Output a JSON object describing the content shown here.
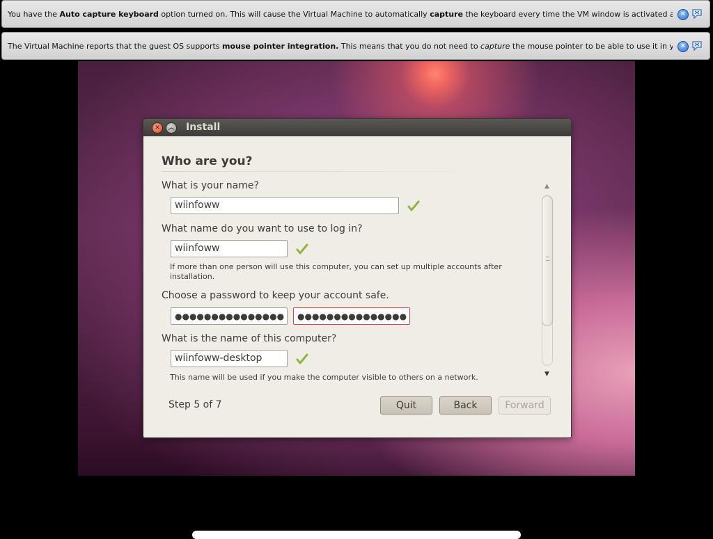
{
  "notifications": [
    {
      "parts": [
        {
          "text": "You have the ",
          "bold": false
        },
        {
          "text": "Auto capture keyboard",
          "bold": true
        },
        {
          "text": " option turned on. This will cause the Virtual Machine to automatically ",
          "bold": false
        },
        {
          "text": "capture",
          "bold": true
        },
        {
          "text": " the keyboard every time the VM window is activated and make it unavailable to",
          "bold": false
        }
      ],
      "close_icon": "close-icon",
      "dismiss_icon": "dismiss-bubble-icon"
    },
    {
      "parts": [
        {
          "text": "The Virtual Machine reports that the guest OS supports ",
          "bold": false
        },
        {
          "text": "mouse pointer integration.",
          "bold": true
        },
        {
          "text": " This means that you do not need to ",
          "bold": false
        },
        {
          "text": "capture",
          "italic": true
        },
        {
          "text": " the mouse pointer to be able to use it in your guest OS -- all mouse",
          "bold": false
        }
      ],
      "close_icon": "close-icon",
      "dismiss_icon": "dismiss-bubble-icon"
    }
  ],
  "window": {
    "title": "Install",
    "close_glyph": "✕",
    "maximize_glyph": "︿"
  },
  "form": {
    "heading": "Who are you?",
    "name_label": "What is your name?",
    "name_value": "wiinfoww",
    "login_label": "What name do you want to use to log in?",
    "login_value": "wiinfoww",
    "login_hint_line1": "If more than one person will use this computer, you can set up multiple accounts after",
    "login_hint_line2": "installation.",
    "password_label": "Choose a password to keep your account safe.",
    "password_value": "●●●●●●●●●●●●●●●",
    "password_confirm_value": "●●●●●●●●●●●●●●●",
    "computer_label": "What is the name of this computer?",
    "computer_value": "wiinfoww-desktop",
    "computer_hint": "This name will be used if you make the computer visible to others on a network."
  },
  "footer": {
    "step": "Step 5 of 7",
    "quit": "Quit",
    "back": "Back",
    "forward": "Forward"
  },
  "colors": {
    "check": "#8cb63c",
    "error_border": "#e04040",
    "titlebar": "#3d3c38",
    "dialog_bg": "#f0ece6"
  }
}
